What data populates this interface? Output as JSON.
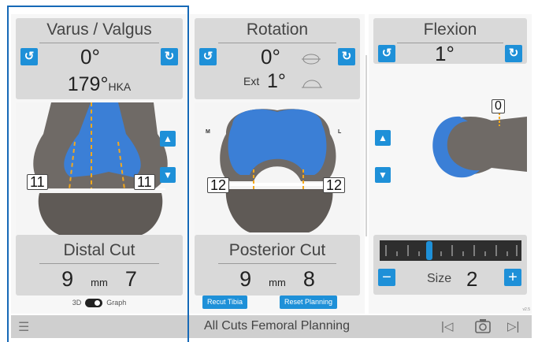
{
  "varus": {
    "title": "Varus / Valgus",
    "angle": "0°",
    "hka_value": "179°",
    "hka_label": "HKA",
    "tag_left": "11",
    "tag_right": "11",
    "cut_title": "Distal Cut",
    "cut_left": "9",
    "cut_unit": "mm",
    "cut_right": "7",
    "toggle_left": "3D",
    "toggle_right": "Graph"
  },
  "rotation": {
    "title": "Rotation",
    "angle": "0°",
    "ext_label": "Ext",
    "ext_value": "1°",
    "side_m": "M",
    "side_l": "L",
    "tag_left": "12",
    "tag_right": "12",
    "cut_title": "Posterior Cut",
    "cut_left": "9",
    "cut_unit": "mm",
    "cut_right": "8",
    "recut_button": "Recut Tibia",
    "reset_button": "Reset Planning"
  },
  "flexion": {
    "title": "Flexion",
    "angle": "1°",
    "tag_top": "0",
    "size_label": "Size",
    "size_value": "2",
    "minus": "−",
    "plus": "+",
    "version": "v2.5"
  },
  "bottom_bar": {
    "title": "All Cuts Femoral Planning"
  },
  "colors": {
    "accent": "#1e90d8",
    "selection": "#1669b7",
    "implant": "#3b7fd6",
    "bone": "#6f6a66"
  },
  "icons": {
    "rotate_ccw": "↺",
    "rotate_cw": "↻",
    "up": "▲",
    "down": "▼",
    "menu": "☰",
    "prev": "|◁",
    "camera": "camera",
    "next": "▷|"
  }
}
